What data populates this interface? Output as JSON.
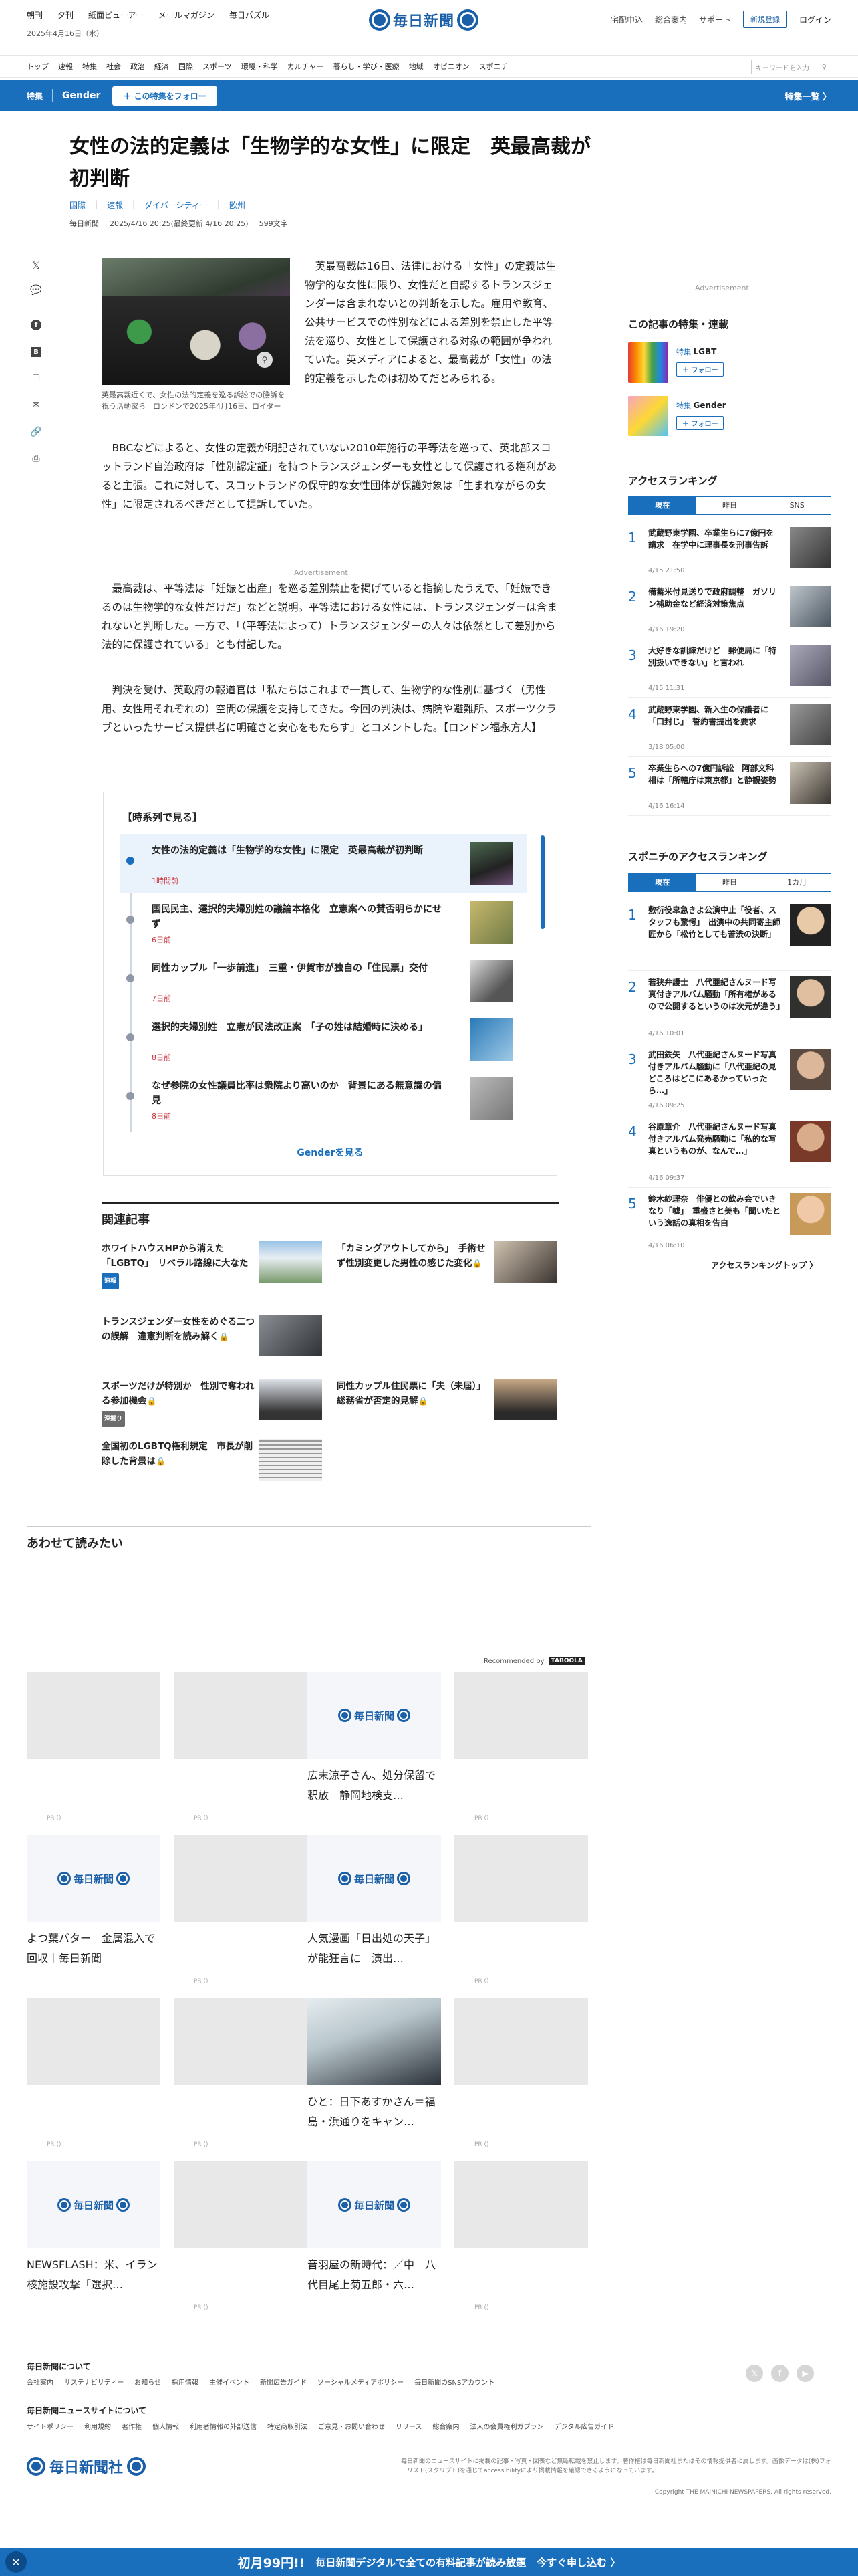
{
  "topbar": {
    "nav": [
      "朝刊",
      "夕刊",
      "紙面ビューアー",
      "メールマガジン",
      "毎日パズル"
    ],
    "date": "2025年4月16日（水）",
    "logo": "毎日新聞",
    "util": [
      "宅配申込",
      "総合案内",
      "サポート"
    ],
    "register": "新規登録",
    "login": "ログイン"
  },
  "sections": [
    "トップ",
    "速報",
    "特集",
    "社会",
    "政治",
    "経済",
    "国際",
    "スポーツ",
    "環境・科学",
    "カルチャー",
    "暮らし・学び・医療",
    "地域",
    "オピニオン",
    "スポニチ"
  ],
  "search_placeholder": "キーワードを入力",
  "special": {
    "label": "特集",
    "topic": "Gender",
    "follow": "＋ この特集をフォロー",
    "list": "特集一覧 〉"
  },
  "article": {
    "headline": "女性の法的定義は「生物学的な女性」に限定　英最高裁が初判断",
    "tags": [
      "国際",
      "速報",
      "ダイバーシティー",
      "欧州"
    ],
    "source": "毎日新聞",
    "date": "2025/4/16 20:25(最終更新 4/16 20:25)",
    "chars": "599文字",
    "caption": "英最高裁近くで、女性の法的定義を巡る訴訟での勝訴を祝う活動家ら＝ロンドンで2025年4月16日、ロイター",
    "p1": "英最高裁は16日、法律における「女性」の定義は生物学的な女性に限り、女性だと自認するトランスジェンダーは含まれないとの判断を示した。雇用や教育、公共サービスでの性別などによる差別を禁止した平等法を巡り、女性として保護される対象の範囲が争われていた。英メディアによると、最高裁が「女性」の法的定義を示したのは初めてだとみられる。",
    "p2": "BBCなどによると、女性の定義が明記されていない2010年施行の平等法を巡って、英北部スコットランド自治政府は「性別認定証」を持つトランスジェンダーも女性として保護される権利があると主張。これに対して、スコットランドの保守的な女性団体が保護対象は「生まれながらの女性」に限定されるべきだとして提訴していた。",
    "ad": "Advertisement",
    "p3": "最高裁は、平等法は「妊娠と出産」を巡る差別禁止を掲げていると指摘したうえで、「妊娠できるのは生物学的な女性だけだ」などと説明。平等法における女性には、トランスジェンダーは含まれないと判断した。一方で、「（平等法によって）トランスジェンダーの人々は依然として差別から法的に保護されている」とも付記した。",
    "p4": "判決を受け、英政府の報道官は「私たちはこれまで一貫して、生物学的な性別に基づく（男性用、女性用それぞれの）空間の保護を支持してきた。今回の判決は、病院や避難所、スポーツクラブといったサービス提供者に明確さと安心をもたらす」とコメントした。【ロンドン福永方人】"
  },
  "timeline": {
    "title": "【時系列で見る】",
    "items": [
      {
        "text": "女性の法的定義は「生物学的な女性」に限定　英最高裁が初判断",
        "time": "1時間前"
      },
      {
        "text": "国民民主、選択的夫婦別姓の議論本格化　立憲案への賛否明らかにせず",
        "time": "6日前"
      },
      {
        "text": "同性カップル「一歩前進」　三重・伊賀市が独自の「住民票」交付",
        "time": "7日前"
      },
      {
        "text": "選択的夫婦別姓　立憲が民法改正案　「子の姓は結婚時に決める」",
        "time": "8日前"
      },
      {
        "text": "なぜ参院の女性議員比率は衆院より高いのか　背景にある無意識の偏見",
        "time": "8日前"
      }
    ],
    "more": "Genderを見る"
  },
  "related": {
    "title": "関連記事",
    "items": [
      {
        "text": "ホワイトハウスHPから消えた「LGBTQ」　リベラル路線に大なた",
        "badge": "速報"
      },
      {
        "text": "「カミングアウトしてから」　手術せず性別変更した男性の感じた変化",
        "badge": ""
      },
      {
        "text": "トランスジェンダー女性をめぐる二つの誤解　違憲判断を読み解く",
        "badge": ""
      },
      {
        "text": "スポーツだけが特別か　性別で奪われる参加機会",
        "badge": "深掘り"
      },
      {
        "text": "同性カップル住民票に「夫（未届）」　総務省が否定的見解",
        "badge": ""
      },
      {
        "text": "全国初のLGBTQ権利規定　市長が削除した背景は",
        "badge": ""
      }
    ]
  },
  "read_together": {
    "title": "あわせて読みたい",
    "recommended_by": "Recommended by",
    "tb": "TABOOLA",
    "cards": [
      {
        "title": "",
        "pr": "PR ()"
      },
      {
        "title": "",
        "pr": "PR ()"
      },
      {
        "title": "広末涼子さん、処分保留で釈放　静岡地検支…",
        "pr": ""
      },
      {
        "title": "",
        "pr": "PR ()"
      },
      {
        "title": "よつ葉バター　金属混入で回収｜毎日新聞",
        "pr": ""
      },
      {
        "title": "",
        "pr": "PR ()"
      },
      {
        "title": "人気漫画「日出処の天子」が能狂言に　演出…",
        "pr": ""
      },
      {
        "title": "",
        "pr": "PR ()"
      },
      {
        "title": "",
        "pr": "PR ()"
      },
      {
        "title": "",
        "pr": "PR ()"
      },
      {
        "title": "ひと：日下あすかさん＝福島・浜通りをキャン…",
        "pr": ""
      },
      {
        "title": "",
        "pr": "PR ()"
      },
      {
        "title": "NEWSFLASH：米、イラン核施設攻撃「選択…",
        "pr": ""
      },
      {
        "title": "",
        "pr": "PR ()"
      },
      {
        "title": "音羽屋の新時代：／中　八代目尾上菊五郎・六…",
        "pr": ""
      },
      {
        "title": "",
        "pr": "PR ()"
      }
    ]
  },
  "sidebar": {
    "ad": "Advertisement",
    "tokushu_title": "この記事の特集・連載",
    "tokushu": [
      {
        "type": "特集",
        "name": "LGBT",
        "follow": "＋ フォロー"
      },
      {
        "type": "特集",
        "name": "Gender",
        "follow": "＋ フォロー"
      }
    ],
    "access_title": "アクセスランキング",
    "access_tabs": [
      "現在",
      "昨日",
      "SNS"
    ],
    "access": [
      {
        "num": "1",
        "text": "武蔵野東学園、卒業生らに7億円を請求　在学中に理事長を刑事告訴",
        "date": "4/15 21:50"
      },
      {
        "num": "2",
        "text": "備蓄米付見送りで政府調整　ガソリン補助金など経済対策焦点",
        "date": "4/16 19:20"
      },
      {
        "num": "3",
        "text": "大好きな訓練だけど　郵便局に「特別扱いできない」と言われ",
        "date": "4/15 11:31"
      },
      {
        "num": "4",
        "text": "武蔵野東学園、新入生の保護者に「口封じ」　誓約書提出を要求",
        "date": "3/18 05:00"
      },
      {
        "num": "5",
        "text": "卒業生らへの7億円訴訟　阿部文科相は「所轄庁は東京都」と静観姿勢",
        "date": "4/16 16:14"
      }
    ],
    "sponichi_title": "スポニチのアクセスランキング",
    "sponichi_tabs": [
      "現在",
      "昨日",
      "1カ月"
    ],
    "sponichi": [
      {
        "num": "1",
        "text": "敷衍役皐急きよ公演中止「役者、スタッフも驚愕」　出演中の共同寄主師匠から「松竹としても苦渋の決断」",
        "date": ""
      },
      {
        "num": "2",
        "text": "若狭弁護士　八代亜紀さんヌード写真付きアルバム騒動「所有権があるので公開するというのは次元が違う」",
        "date": "4/16 10:01"
      },
      {
        "num": "3",
        "text": "武田鉄矢　八代亜紀さんヌード写真付きアルバム騒動に「八代亜紀の見どころはどこにあるかっていったら…」",
        "date": "4/16 09:25"
      },
      {
        "num": "4",
        "text": "谷原章介　八代亜紀さんヌード写真付きアルバム発売騒動に「私的な写真というものが、なんで…」",
        "date": "4/16 09:37"
      },
      {
        "num": "5",
        "text": "鈴木紗理奈　俳優との飲み会でいきなり「嘘」　重盛さと美も「聞いたという逸話の真相を告白",
        "date": "4/16 06:10"
      }
    ],
    "more": "アクセスランキングトップ 〉"
  },
  "footer": {
    "h1": "毎日新聞について",
    "links1": [
      "会社案内",
      "サステナビリティー",
      "お知らせ",
      "採用情報",
      "主催イベント",
      "新聞広告ガイド",
      "ソーシャルメディアポリシー",
      "毎日新聞のSNSアカウント"
    ],
    "h2": "毎日新聞ニュースサイトについて",
    "links2": [
      "サイトポリシー",
      "利用規約",
      "著作権",
      "個人情報",
      "利用者情報の外部送信",
      "特定商取引法",
      "ご意見・お問い合わせ",
      "リリース",
      "総合案内",
      "法人の会員権利ガプラン",
      "デジタル広告ガイド"
    ],
    "logo": "毎日新聞社",
    "note": "毎日新聞のニュースサイトに掲載の記事・写真・図表など無断転載を禁止します。著作権は毎日新聞社またはその情報提供者に属します。画像データは(株)フォーリスト(スクリプト)を通じてaccessibilityにより掲載情報を確認できるようになっています。",
    "copyright": "Copyright THE MAINICHI NEWSPAPERS. All rights reserved."
  },
  "promo": {
    "big": "初月99円!!",
    "mid": "毎日新聞デジタルで全ての有料記事が読み放題",
    "cta": "今すぐ申し込む 〉"
  }
}
